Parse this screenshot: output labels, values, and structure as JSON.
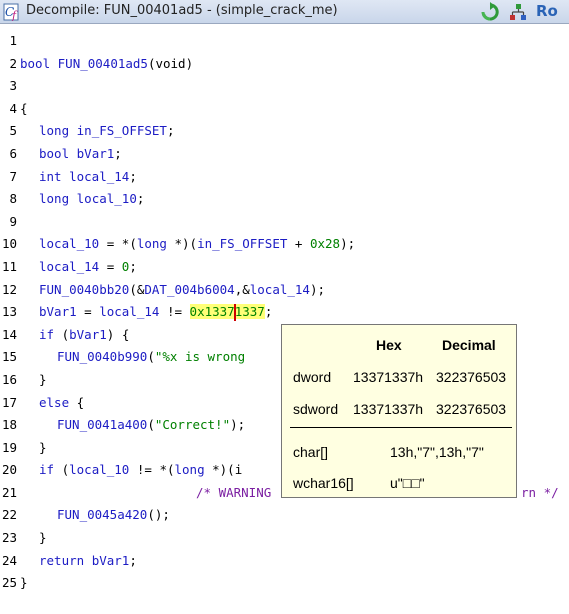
{
  "window": {
    "title": "Decompile: FUN_00401ad5 - (simple_crack_me)",
    "read_only_label": "Ro",
    "icons": [
      "decompile-icon",
      "refresh-icon",
      "graph-icon"
    ]
  },
  "code": {
    "lines": [
      {
        "n": "1"
      },
      {
        "n": "2"
      },
      {
        "n": "3"
      },
      {
        "n": "4"
      },
      {
        "n": "5"
      },
      {
        "n": "6"
      },
      {
        "n": "7"
      },
      {
        "n": "8"
      },
      {
        "n": "9"
      },
      {
        "n": "10"
      },
      {
        "n": "11"
      },
      {
        "n": "12"
      },
      {
        "n": "13"
      },
      {
        "n": "14"
      },
      {
        "n": "15"
      },
      {
        "n": "16"
      },
      {
        "n": "17"
      },
      {
        "n": "18"
      },
      {
        "n": "19"
      },
      {
        "n": "20"
      },
      {
        "n": "21"
      },
      {
        "n": "22"
      },
      {
        "n": "23"
      },
      {
        "n": "24"
      },
      {
        "n": "25"
      }
    ],
    "tokens": {
      "l2_type": "bool",
      "l2_fn": "FUN_00401ad5",
      "l2_params": "(void)",
      "l4": "{",
      "l5_type": "long",
      "l5_var": "in_FS_OFFSET",
      "l5_end": ";",
      "l6_type": "bool",
      "l6_var": "bVar1",
      "l6_end": ";",
      "l7_type": "int",
      "l7_var": "local_14",
      "l7_end": ";",
      "l8_type": "long",
      "l8_var": "local_10",
      "l8_end": ";",
      "l10_var": "local_10",
      "l10_a": " = *(",
      "l10_type": "long",
      "l10_b": " *)(",
      "l10_var2": "in_FS_OFFSET",
      "l10_c": " + ",
      "l10_num": "0x28",
      "l10_end": ");",
      "l11_var": "local_14",
      "l11_a": " = ",
      "l11_num": "0",
      "l11_end": ";",
      "l12_fn": "FUN_0040bb20",
      "l12_a": "(&",
      "l12_glob": "DAT_004b6004",
      "l12_b": ",&",
      "l12_var": "local_14",
      "l12_end": ");",
      "l13_var": "bVar1",
      "l13_a": " = ",
      "l13_var2": "local_14",
      "l13_b": " != ",
      "l13_num1": "0x1337",
      "l13_num2": "1337",
      "l13_end": ";",
      "l14_kw": "if",
      "l14_a": " (",
      "l14_var": "bVar1",
      "l14_end": ") {",
      "l15_fn": "FUN_0040b990",
      "l15_a": "(",
      "l15_str": "\"%x is wrong",
      "l16": "}",
      "l17_kw": "else",
      "l17_end": " {",
      "l18_fn": "FUN_0041a400",
      "l18_a": "(",
      "l18_str": "\"Correct!\"",
      "l18_end": ");",
      "l19": "}",
      "l20_kw": "if",
      "l20_a": " (",
      "l20_var": "local_10",
      "l20_b": " != *(",
      "l20_type": "long",
      "l20_c": " *)(i",
      "l21_cmt1": "/* WARNING",
      "l21_cmt2": "rn */",
      "l22_fn": "FUN_0045a420",
      "l22_end": "();",
      "l23": "}",
      "l24_kw": "return",
      "l24_var": "bVar1",
      "l24_end": ";",
      "l25": "}"
    }
  },
  "tooltip": {
    "headers": {
      "hex": "Hex",
      "decimal": "Decimal"
    },
    "rows": [
      {
        "label": "dword",
        "hex": "13371337h",
        "decimal": "322376503"
      },
      {
        "label": "sdword",
        "hex": "13371337h",
        "decimal": "322376503"
      }
    ],
    "char_label": "char[]",
    "char_value": "13h,\"7\",13h,\"7\"",
    "wchar_label": "wchar16[]",
    "wchar_value": "u\"□□\""
  }
}
